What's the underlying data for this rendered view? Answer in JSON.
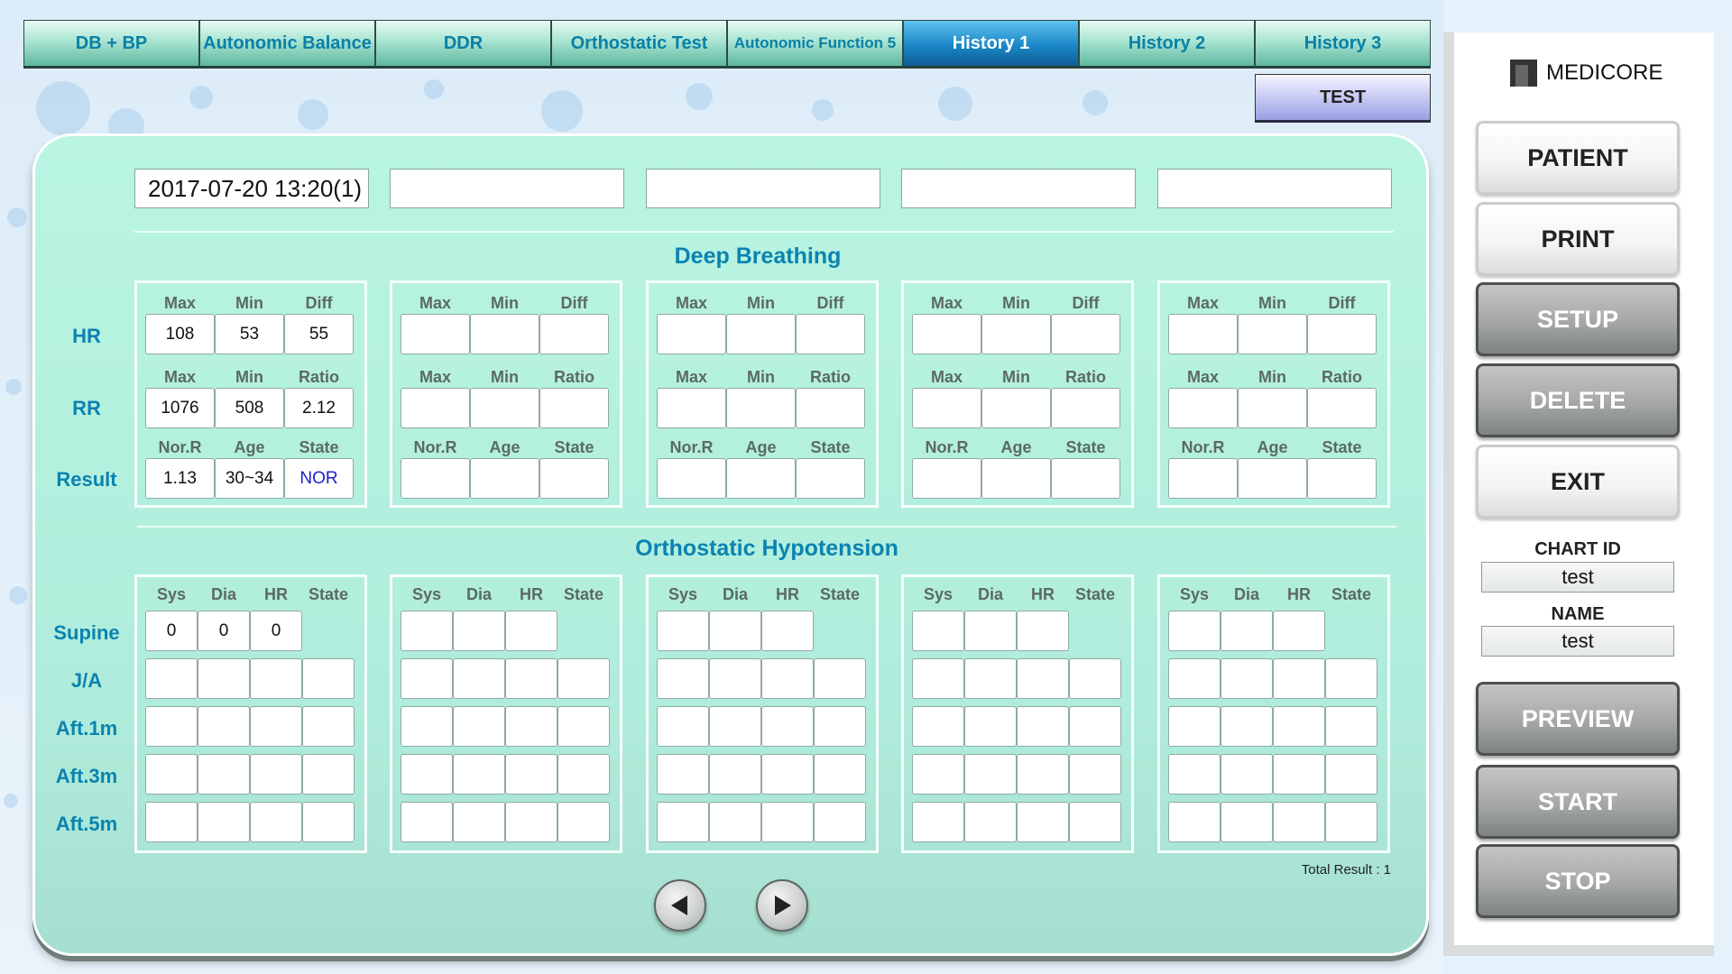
{
  "tabs": [
    {
      "label": "DB + BP",
      "active": false
    },
    {
      "label": "Autonomic Balance",
      "active": false
    },
    {
      "label": "DDR",
      "active": false
    },
    {
      "label": "Orthostatic Test",
      "active": false
    },
    {
      "label": "Autonomic Function 5",
      "active": false
    },
    {
      "label": "History 1",
      "active": true
    },
    {
      "label": "History 2",
      "active": false
    },
    {
      "label": "History 3",
      "active": false
    }
  ],
  "test_button": "TEST",
  "dates": [
    "2017-07-20 13:20(1)",
    "",
    "",
    "",
    ""
  ],
  "deep_breathing": {
    "title": "Deep Breathing",
    "row_labels": {
      "hr": "HR",
      "rr": "RR",
      "result": "Result"
    },
    "headers": {
      "hr": [
        "Max",
        "Min",
        "Diff"
      ],
      "rr": [
        "Max",
        "Min",
        "Ratio"
      ],
      "result": [
        "Nor.R",
        "Age",
        "State"
      ]
    },
    "groups": [
      {
        "hr": [
          "108",
          "53",
          "55"
        ],
        "rr": [
          "1076",
          "508",
          "2.12"
        ],
        "result": [
          "1.13",
          "30~34",
          "NOR"
        ]
      },
      {
        "hr": [
          "",
          "",
          ""
        ],
        "rr": [
          "",
          "",
          ""
        ],
        "result": [
          "",
          "",
          ""
        ]
      },
      {
        "hr": [
          "",
          "",
          ""
        ],
        "rr": [
          "",
          "",
          ""
        ],
        "result": [
          "",
          "",
          ""
        ]
      },
      {
        "hr": [
          "",
          "",
          ""
        ],
        "rr": [
          "",
          "",
          ""
        ],
        "result": [
          "",
          "",
          ""
        ]
      },
      {
        "hr": [
          "",
          "",
          ""
        ],
        "rr": [
          "",
          "",
          ""
        ],
        "result": [
          "",
          "",
          ""
        ]
      }
    ]
  },
  "orthostatic": {
    "title": "Orthostatic Hypotension",
    "row_labels": [
      "Supine",
      "J/A",
      "Aft.1m",
      "Aft.3m",
      "Aft.5m"
    ],
    "headers": [
      "Sys",
      "Dia",
      "HR",
      "State"
    ],
    "groups": [
      {
        "supine": [
          "0",
          "0",
          "0"
        ],
        "rows": [
          [
            "",
            "",
            "",
            ""
          ],
          [
            "",
            "",
            "",
            ""
          ],
          [
            "",
            "",
            "",
            ""
          ],
          [
            "",
            "",
            "",
            ""
          ]
        ]
      },
      {
        "supine": [
          "",
          "",
          ""
        ],
        "rows": [
          [
            "",
            "",
            "",
            ""
          ],
          [
            "",
            "",
            "",
            ""
          ],
          [
            "",
            "",
            "",
            ""
          ],
          [
            "",
            "",
            "",
            ""
          ]
        ]
      },
      {
        "supine": [
          "",
          "",
          ""
        ],
        "rows": [
          [
            "",
            "",
            "",
            ""
          ],
          [
            "",
            "",
            "",
            ""
          ],
          [
            "",
            "",
            "",
            ""
          ],
          [
            "",
            "",
            "",
            ""
          ]
        ]
      },
      {
        "supine": [
          "",
          "",
          ""
        ],
        "rows": [
          [
            "",
            "",
            "",
            ""
          ],
          [
            "",
            "",
            "",
            ""
          ],
          [
            "",
            "",
            "",
            ""
          ],
          [
            "",
            "",
            "",
            ""
          ]
        ]
      },
      {
        "supine": [
          "",
          "",
          ""
        ],
        "rows": [
          [
            "",
            "",
            "",
            ""
          ],
          [
            "",
            "",
            "",
            ""
          ],
          [
            "",
            "",
            "",
            ""
          ],
          [
            "",
            "",
            "",
            ""
          ]
        ]
      }
    ]
  },
  "total_result": "Total Result : 1",
  "nav": {
    "prev_icon": "triangle-left-icon",
    "next_icon": "triangle-right-icon"
  },
  "sidebar": {
    "logo_text": "MEDICORE",
    "buttons_top": [
      "PATIENT",
      "PRINT",
      "SETUP",
      "DELETE",
      "EXIT"
    ],
    "chart_id_label": "CHART ID",
    "chart_id_value": "test",
    "name_label": "NAME",
    "name_value": "test",
    "buttons_bottom": [
      "PREVIEW",
      "START",
      "STOP"
    ]
  },
  "colors": {
    "accent": "#0b83b0",
    "active_tab": "#1b87c8",
    "panel": "#b9f5e2",
    "state_nor": "#1a20c8"
  }
}
